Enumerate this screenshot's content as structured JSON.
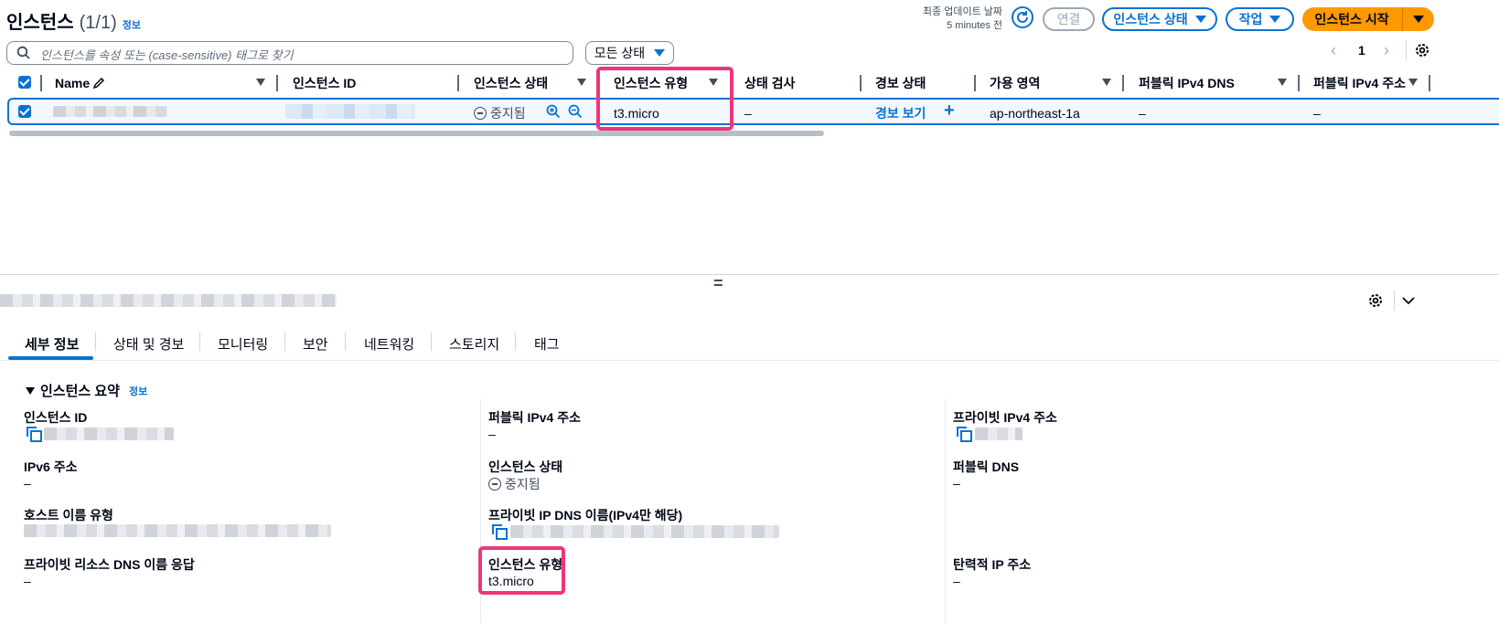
{
  "header": {
    "title": "인스턴스",
    "count": "(1/1)",
    "info_link": "정보",
    "last_updated_label": "최종 업데이트 날짜",
    "last_updated_value": "5 minutes 전",
    "connect_label": "연결",
    "instance_state_label": "인스턴스 상태",
    "actions_label": "작업",
    "start_instance_label": "인스턴스 시작"
  },
  "search": {
    "placeholder": "인스턴스를 속성 또는 (case-sensitive) 태그로 찾기",
    "state_filter": "모든 상태"
  },
  "pagination": {
    "current_page": "1"
  },
  "table": {
    "columns": [
      "Name",
      "인스턴스 ID",
      "인스턴스 상태",
      "인스턴스 유형",
      "상태 검사",
      "경보 상태",
      "가용 영역",
      "퍼블릭 IPv4 DNS",
      "퍼블릭 IPv4 주소"
    ],
    "rows": [
      {
        "state": "중지됨",
        "type": "t3.micro",
        "status_check": "–",
        "alarm": "경보 보기",
        "az": "ap-northeast-1a",
        "public_dns": "–",
        "public_ip": "–"
      }
    ]
  },
  "splitter": "=",
  "tabs": [
    "세부 정보",
    "상태 및 경보",
    "모니터링",
    "보안",
    "네트워킹",
    "스토리지",
    "태그"
  ],
  "summary": {
    "title": "인스턴스 요약",
    "info_link": "정보",
    "fields": {
      "instance_id_label": "인스턴스 ID",
      "public_ipv4_label": "퍼블릭 IPv4 주소",
      "public_ipv4_value": "–",
      "private_ipv4_label": "프라이빗 IPv4 주소",
      "ipv6_label": "IPv6 주소",
      "ipv6_value": "–",
      "instance_state_label": "인스턴스 상태",
      "instance_state_value": "중지됨",
      "public_dns_label": "퍼블릭 DNS",
      "public_dns_value": "–",
      "hostname_type_label": "호스트 이름 유형",
      "private_ip_dns_label": "프라이빗 IP DNS 이름(IPv4만 해당)",
      "private_resource_dns_label": "프라이빗 리소스 DNS 이름 응답",
      "private_resource_dns_value": "–",
      "instance_type_label": "인스턴스 유형",
      "instance_type_value": "t3.micro",
      "elastic_ip_label": "탄력적 IP 주소",
      "elastic_ip_value": "–"
    }
  },
  "colors": {
    "primary": "#0972d3",
    "start_button": "#ff9900",
    "highlight": "#f0357a",
    "selected_row": "#f2f8fd"
  }
}
